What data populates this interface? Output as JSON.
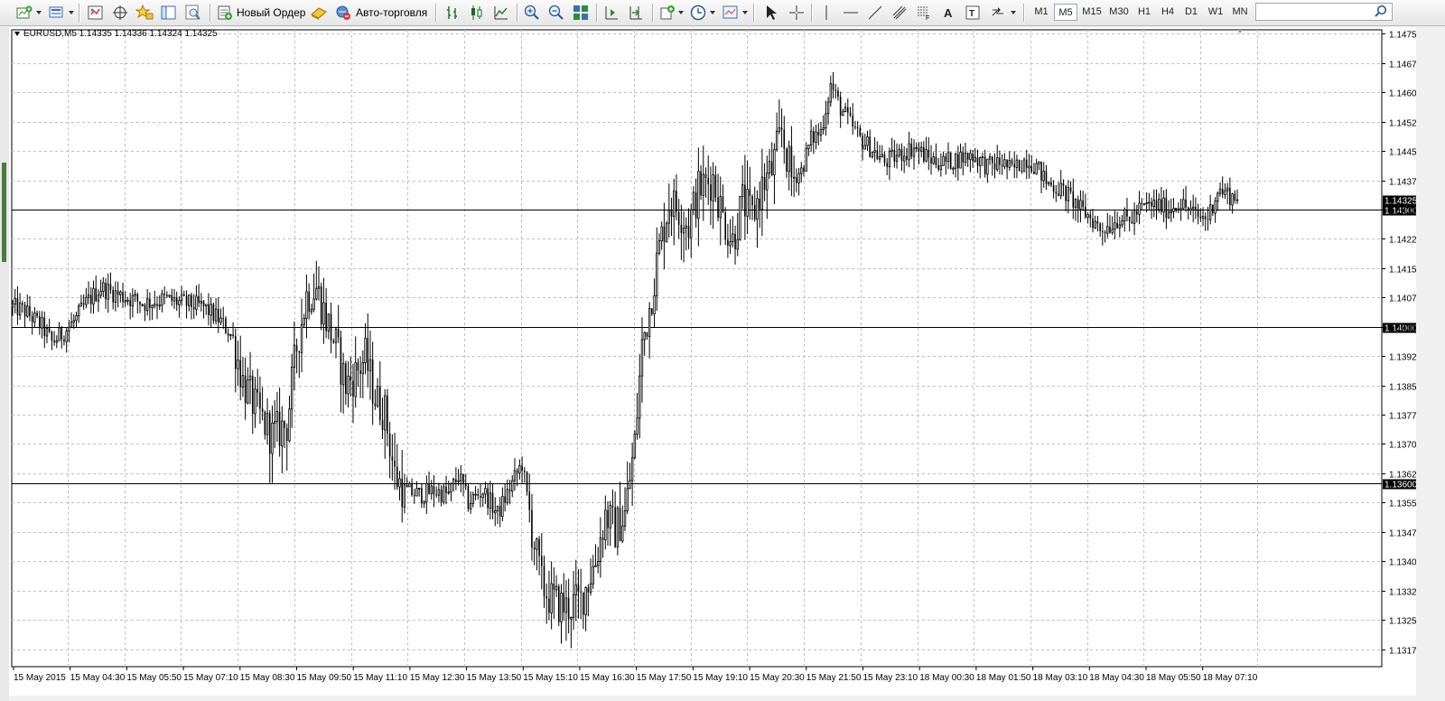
{
  "toolbar": {
    "new_order_label": "Новый Ордер",
    "auto_trading_label": "Авто-торговля",
    "timeframes": [
      "M1",
      "M5",
      "M15",
      "M30",
      "H1",
      "H4",
      "D1",
      "W1",
      "MN"
    ],
    "active_timeframe": "M5"
  },
  "chart": {
    "symbol_line": "EURUSD,M5  1.14335 1.14336 1.14324 1.14325"
  },
  "chart_data": {
    "type": "candlestick",
    "symbol": "EURUSD",
    "timeframe": "M5",
    "ohlc_header": {
      "open": 1.14335,
      "high": 1.14336,
      "low": 1.14324,
      "close": 1.14325
    },
    "ylim": [
      1.1313,
      1.1476
    ],
    "y_ticks": [
      "1.14750",
      "1.14675",
      "1.14600",
      "1.14525",
      "1.14450",
      "1.14375",
      "1.14300",
      "1.14225",
      "1.14150",
      "1.14075",
      "1.14000",
      "1.13925",
      "1.13850",
      "1.13775",
      "1.13700",
      "1.13625",
      "1.13550",
      "1.13475",
      "1.13400",
      "1.13325",
      "1.13250",
      "1.13175"
    ],
    "x_ticks": [
      "15 May 2015",
      "15 May 04:30",
      "15 May 05:50",
      "15 May 07:10",
      "15 May 08:30",
      "15 May 09:50",
      "15 May 11:10",
      "15 May 12:30",
      "15 May 13:50",
      "15 May 15:10",
      "15 May 16:30",
      "15 May 17:50",
      "15 May 19:10",
      "15 May 20:30",
      "15 May 21:50",
      "15 May 23:10",
      "18 May 00:30",
      "18 May 01:50",
      "18 May 03:10",
      "18 May 04:30",
      "18 May 05:50",
      "18 May 07:10"
    ],
    "grid": true,
    "horizontal_lines": [
      1.143,
      1.14,
      1.136
    ],
    "horizontal_line_labels": [
      "1.14300",
      "1.14000",
      "1.13600"
    ],
    "current_price_label": "1.14325",
    "current_price": 1.14325,
    "path": [
      [
        0,
        1.1405
      ],
      [
        5,
        1.1404
      ],
      [
        12,
        1.14
      ],
      [
        16,
        1.1396
      ],
      [
        20,
        1.1398
      ],
      [
        26,
        1.1402
      ],
      [
        30,
        1.1406
      ],
      [
        36,
        1.141
      ],
      [
        44,
        1.1408
      ],
      [
        54,
        1.1406
      ],
      [
        62,
        1.1407
      ],
      [
        70,
        1.1406
      ],
      [
        78,
        1.1405
      ],
      [
        84,
        1.1402
      ],
      [
        88,
        1.1399
      ],
      [
        90,
        1.1397
      ],
      [
        94,
        1.1386
      ],
      [
        100,
        1.1378
      ],
      [
        106,
        1.1372
      ],
      [
        112,
        1.1375
      ],
      [
        116,
        1.1395
      ],
      [
        120,
        1.1408
      ],
      [
        124,
        1.141
      ],
      [
        128,
        1.1402
      ],
      [
        132,
        1.1395
      ],
      [
        136,
        1.1385
      ],
      [
        140,
        1.1388
      ],
      [
        144,
        1.1392
      ],
      [
        148,
        1.1382
      ],
      [
        152,
        1.1378
      ],
      [
        156,
        1.1362
      ],
      [
        160,
        1.1358
      ],
      [
        166,
        1.1357
      ],
      [
        172,
        1.1358
      ],
      [
        178,
        1.1357
      ],
      [
        182,
        1.1362
      ],
      [
        186,
        1.1355
      ],
      [
        192,
        1.1358
      ],
      [
        198,
        1.1352
      ],
      [
        204,
        1.136
      ],
      [
        208,
        1.1365
      ],
      [
        212,
        1.1348
      ],
      [
        216,
        1.1334
      ],
      [
        220,
        1.133
      ],
      [
        226,
        1.1328
      ],
      [
        232,
        1.133
      ],
      [
        238,
        1.134
      ],
      [
        242,
        1.1352
      ],
      [
        246,
        1.1348
      ],
      [
        250,
        1.1352
      ],
      [
        254,
        1.137
      ],
      [
        257,
        1.1395
      ],
      [
        260,
        1.1405
      ],
      [
        264,
        1.142
      ],
      [
        268,
        1.1432
      ],
      [
        272,
        1.143
      ],
      [
        276,
        1.1426
      ],
      [
        280,
        1.1435
      ],
      [
        286,
        1.1438
      ],
      [
        290,
        1.1428
      ],
      [
        294,
        1.1422
      ],
      [
        298,
        1.1432
      ],
      [
        302,
        1.1428
      ],
      [
        306,
        1.1436
      ],
      [
        310,
        1.144
      ],
      [
        314,
        1.145
      ],
      [
        318,
        1.1438
      ],
      [
        322,
        1.144
      ],
      [
        326,
        1.1448
      ],
      [
        330,
        1.145
      ],
      [
        334,
        1.1462
      ],
      [
        338,
        1.1456
      ],
      [
        342,
        1.1452
      ],
      [
        346,
        1.1448
      ],
      [
        350,
        1.1446
      ],
      [
        356,
        1.1442
      ],
      [
        362,
        1.1444
      ],
      [
        368,
        1.1446
      ],
      [
        374,
        1.1443
      ],
      [
        380,
        1.1442
      ],
      [
        386,
        1.1443
      ],
      [
        392,
        1.1444
      ],
      [
        398,
        1.1441
      ],
      [
        404,
        1.1442
      ],
      [
        408,
        1.144
      ],
      [
        414,
        1.1443
      ],
      [
        418,
        1.1441
      ],
      [
        422,
        1.1437
      ],
      [
        428,
        1.1435
      ],
      [
        432,
        1.1433
      ],
      [
        436,
        1.143
      ],
      [
        440,
        1.1428
      ],
      [
        444,
        1.1425
      ],
      [
        448,
        1.1426
      ],
      [
        452,
        1.1428
      ],
      [
        456,
        1.1427
      ],
      [
        460,
        1.143
      ],
      [
        464,
        1.1431
      ],
      [
        468,
        1.1431
      ],
      [
        472,
        1.143
      ],
      [
        476,
        1.1432
      ],
      [
        480,
        1.143
      ],
      [
        484,
        1.1428
      ],
      [
        488,
        1.1428
      ],
      [
        492,
        1.1435
      ],
      [
        496,
        1.1434
      ],
      [
        500,
        1.14325
      ]
    ]
  }
}
